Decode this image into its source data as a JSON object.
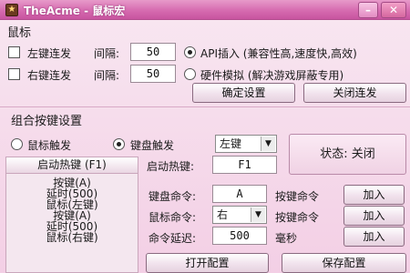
{
  "window": {
    "title": "TheAcme - 鼠标宏",
    "icon_glyph": "★",
    "minimize_glyph": "–",
    "close_glyph": "✕"
  },
  "mouse_section": {
    "title": "鼠标",
    "left_click": {
      "label": "左键连发",
      "checked": false
    },
    "right_click": {
      "label": "右键连发",
      "checked": false
    },
    "interval_label": "间隔:",
    "left_interval": "50",
    "right_interval": "50",
    "mode_api": {
      "label": "API插入 (兼容性高,速度快,高效)",
      "selected": true
    },
    "mode_hw": {
      "label": "硬件模拟 (解决游戏屏蔽专用)",
      "selected": false
    },
    "confirm_button": "确定设置",
    "close_repeat_button": "关闭连发"
  },
  "combo_section": {
    "title": "组合按键设置",
    "trigger_mouse": {
      "label": "鼠标触发",
      "selected": false
    },
    "trigger_keyboard": {
      "label": "键盘触发",
      "selected": true
    },
    "button_select": "左键",
    "status": "状态: 关闭",
    "start_hotkey_header": "启动热键 (F1)",
    "hotkey_label": "启动热键:",
    "hotkey_value": "F1",
    "keyboard_cmd_label": "键盘命令:",
    "keyboard_cmd_value": "A",
    "mouse_cmd_label": "鼠标命令:",
    "mouse_cmd_value": "右",
    "delay_label": "命令延迟:",
    "delay_value": "500",
    "delay_unit": "毫秒",
    "key_cmd_1": "按键命令",
    "key_cmd_2": "按键命令",
    "add_1": "加入",
    "add_2": "加入",
    "add_3": "加入",
    "open_config": "打开配置",
    "save_config": "保存配置",
    "command_list": [
      "按键(A)",
      "延时(500)",
      "鼠标(左键)",
      "按键(A)",
      "延时(500)",
      "鼠标(右键)"
    ]
  }
}
